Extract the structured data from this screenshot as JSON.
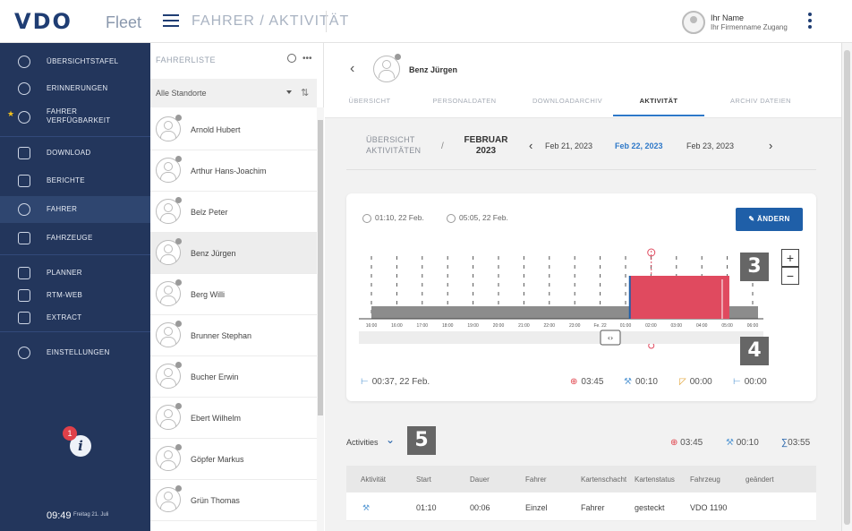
{
  "header": {
    "logo": "VDO",
    "logo_sub": "Fleet",
    "breadcrumb": "FAHRER / AKTIVITÄT",
    "user_name": "Ihr Name",
    "user_sub": "Ihr Firmenname Zugang"
  },
  "sidebar": {
    "items": [
      {
        "label": "ÜBERSICHTSTAFEL",
        "icon": "dashboard-icon"
      },
      {
        "label": "ERINNERUNGEN",
        "icon": "bell-icon"
      },
      {
        "label": "FAHRER VERFÜGBARKEIT",
        "icon": "steering-wheel-icon"
      },
      {
        "label": "DOWNLOAD",
        "icon": "download-icon"
      },
      {
        "label": "BERICHTE",
        "icon": "report-icon"
      },
      {
        "label": "FAHRER",
        "icon": "steering-wheel-icon"
      },
      {
        "label": "FAHRZEUGE",
        "icon": "truck-icon"
      },
      {
        "label": "PLANNER",
        "icon": "planner-icon"
      },
      {
        "label": "RTM-WEB",
        "icon": "rtm-web-icon"
      },
      {
        "label": "EXTRACT",
        "icon": "extract-icon"
      },
      {
        "label": "EINSTELLUNGEN",
        "icon": "gear-icon"
      }
    ],
    "badge_count": "1",
    "time": "09:49",
    "date": "Freitag 21. Juli"
  },
  "driver_list": {
    "title": "FAHRERLISTE",
    "location": "Alle Standorte",
    "drivers": [
      "Arnold Hubert",
      "Arthur Hans-Joachim",
      "Belz Peter",
      "Benz Jürgen",
      "Berg Willi",
      "Brunner Stephan",
      "Bucher Erwin",
      "Ebert Wilhelm",
      "Göpfer Markus",
      "Grün Thomas"
    ]
  },
  "profile": {
    "name": "Benz Jürgen",
    "tabs": [
      "ÜBERSICHT",
      "PERSONALDATEN",
      "DOWNLOADARCHIV",
      "AKTIVITÄT",
      "ARCHIV DATEIEN"
    ],
    "active_tab": 3
  },
  "date_nav": {
    "overview": "ÜBERSICHT AKTIVITÄTEN",
    "month": "FEBRUAR 2023",
    "dates": [
      "Feb 21, 2023",
      "Feb 22, 2023",
      "Feb 23, 2023"
    ],
    "current": 1
  },
  "card": {
    "start": "01:10, 22 Feb.",
    "end": "05:05, 22 Feb.",
    "edit_label": "ÄNDERN",
    "zoom_in": "+",
    "zoom_out": "−",
    "bottom_left": "00:37, 22 Feb.",
    "driving": "03:45",
    "work": "00:10",
    "available": "00:00",
    "rest": "00:00"
  },
  "timeline": {
    "ticks": [
      "16:00",
      "16:00",
      "17:00",
      "18:00",
      "19:00",
      "20:00",
      "21:00",
      "22:00",
      "23:00",
      "Fe. 22",
      "01:00",
      "02:00",
      "03:00",
      "04:00",
      "05:00",
      "06:00"
    ],
    "drive_block": {
      "start": "01:10",
      "end": "05:05"
    },
    "colors": {
      "rest": "#8c8c8c",
      "drive": "#e04a5f",
      "marker": "#1f5fa8"
    }
  },
  "activities": {
    "label": "Activities",
    "driving_total": "03:45",
    "work_total": "00:10",
    "sum_total": "03:55",
    "columns": [
      "Aktivität",
      "Start",
      "Dauer",
      "Fahrer",
      "Kartenschacht",
      "Kartenstatus",
      "Fahrzeug",
      "geändert"
    ],
    "rows": [
      {
        "start": "01:10",
        "duration": "00:06",
        "driver": "Einzel",
        "slot": "Fahrer",
        "status": "gesteckt",
        "vehicle": "VDO 1190",
        "changed": ""
      }
    ]
  },
  "callouts": [
    "3",
    "4",
    "5"
  ]
}
